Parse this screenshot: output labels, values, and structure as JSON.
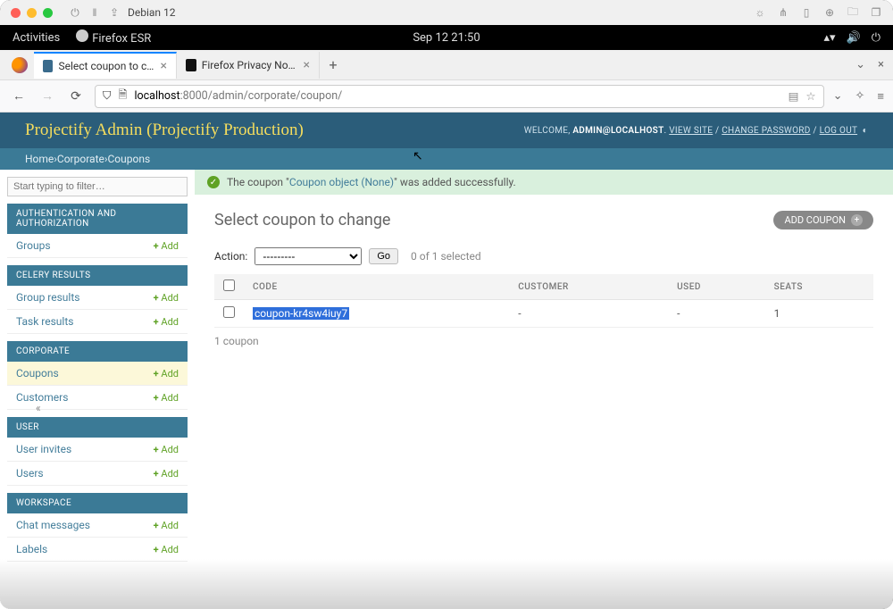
{
  "titlebar": {
    "os_label": "Debian 12"
  },
  "gnome": {
    "activities": "Activities",
    "app": "Firefox ESR",
    "clock": "Sep 12  21:50"
  },
  "tabs": {
    "active": {
      "title": "Select coupon to change"
    },
    "other": {
      "title": "Firefox Privacy Notice —"
    }
  },
  "url": {
    "host": "localhost",
    "rest": ":8000/admin/corporate/coupon/"
  },
  "header": {
    "title": "Projectify Admin (Projectify Production)",
    "welcome": "WELCOME,",
    "user": "ADMIN@LOCALHOST",
    "view_site": "VIEW SITE",
    "change_pw": "CHANGE PASSWORD",
    "log_out": "LOG OUT"
  },
  "breadcrumbs": {
    "home": "Home",
    "sep1": " › ",
    "corporate": "Corporate",
    "sep2": " › ",
    "current": "Coupons"
  },
  "sidebar": {
    "filter_placeholder": "Start typing to filter…",
    "add_label": "Add",
    "sections": {
      "auth": {
        "title": "AUTHENTICATION AND AUTHORIZATION",
        "items": [
          "Groups"
        ]
      },
      "celery": {
        "title": "CELERY RESULTS",
        "items": [
          "Group results",
          "Task results"
        ]
      },
      "corporate": {
        "title": "CORPORATE",
        "items": [
          "Coupons",
          "Customers"
        ]
      },
      "user": {
        "title": "USER",
        "items": [
          "User invites",
          "Users"
        ]
      },
      "workspace": {
        "title": "WORKSPACE",
        "items": [
          "Chat messages",
          "Labels"
        ]
      }
    }
  },
  "success": {
    "pre": "The coupon \"",
    "link": "Coupon object (None)",
    "post": "\" was added successfully."
  },
  "main": {
    "heading": "Select coupon to change",
    "add_button": "ADD COUPON",
    "action_label": "Action:",
    "action_placeholder": "---------",
    "go": "Go",
    "sel_count": "0 of 1 selected",
    "columns": {
      "code": "CODE",
      "customer": "CUSTOMER",
      "used": "USED",
      "seats": "SEATS"
    },
    "rows": [
      {
        "code": "coupon-kr4sw4iuy7",
        "customer": "-",
        "used": "-",
        "seats": "1"
      }
    ],
    "paginator": "1 coupon"
  }
}
